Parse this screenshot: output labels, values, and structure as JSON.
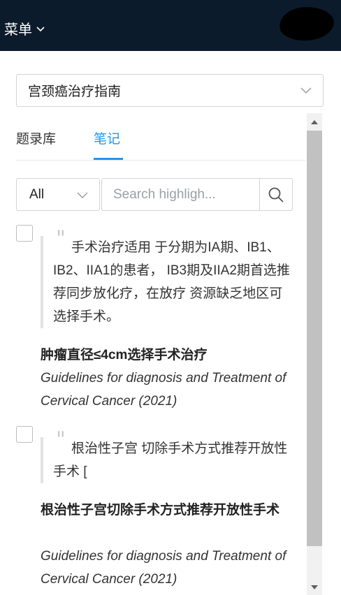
{
  "header": {
    "menu_label": "菜单"
  },
  "book_select": {
    "selected": "宫颈癌治疗指南"
  },
  "tabs": [
    {
      "label": "题录库",
      "active": false
    },
    {
      "label": "笔记",
      "active": true
    }
  ],
  "filter": {
    "selected": "All"
  },
  "search": {
    "placeholder": "Search highligh..."
  },
  "notes": [
    {
      "quote": "手术治疗适用 于分期为IA期、IB1、IB2、IIA1的患者， IB3期及IIA2期首选推荐同步放化疗，在放疗 资源缺乏地区可选择手术。",
      "title": "肿瘤直径≤4cm选择手术治疗",
      "source": "Guidelines for diagnosis and Treatment of Cervical Cancer (2021)"
    },
    {
      "quote": "根治性子宫 切除手术方式推荐开放性手术 [",
      "title": "根治性子宫切除手术方式推荐开放性手术",
      "source": "Guidelines for diagnosis and Treatment of Cervical Cancer (2021)"
    }
  ],
  "colors": {
    "header_bg": "#0c1b2c",
    "accent": "#2196f3"
  }
}
